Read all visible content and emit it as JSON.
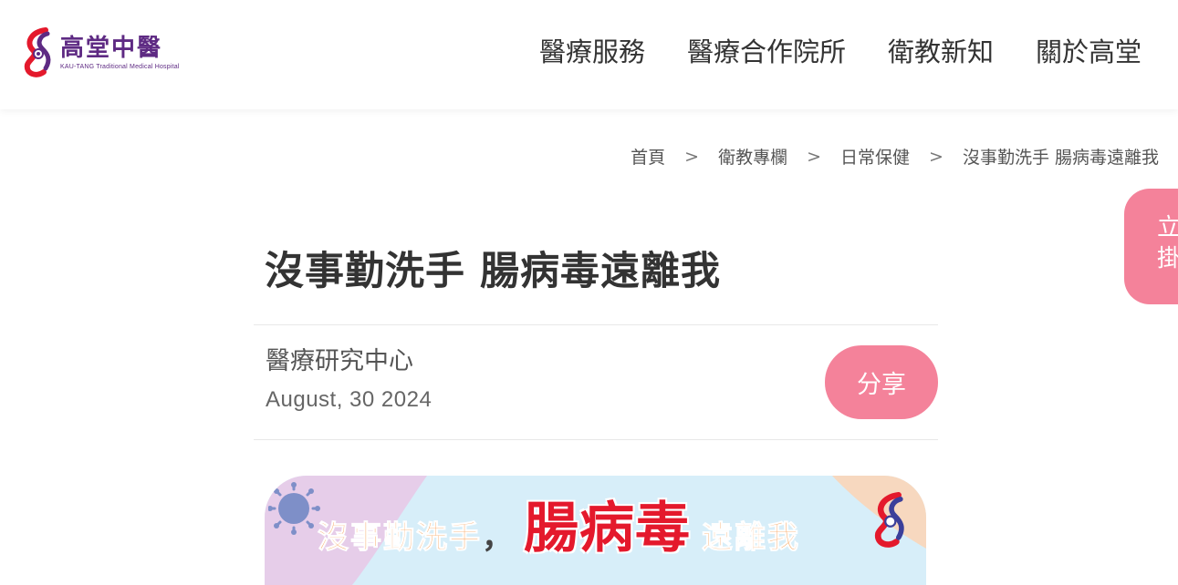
{
  "header": {
    "logo": {
      "name_cn": "高堂中醫",
      "name_en": "KAU-TANG Traditional Medical Hospital"
    },
    "nav": [
      {
        "label": "醫療服務"
      },
      {
        "label": "醫療合作院所"
      },
      {
        "label": "衛教新知"
      },
      {
        "label": "關於高堂"
      }
    ]
  },
  "breadcrumb": {
    "items": [
      "首頁",
      "衛教專欄",
      "日常保健",
      "沒事勤洗手 腸病毒遠離我"
    ],
    "separator": ">"
  },
  "floating_button": {
    "line1": "立",
    "line2": "掛"
  },
  "article": {
    "title": "沒事勤洗手 腸病毒遠離我",
    "author": "醫療研究中心",
    "date": "August, 30 2024",
    "share_label": "分享"
  },
  "banner": {
    "text_part1": "沒事勤洗手",
    "separator": "，",
    "text_main": "腸病毒",
    "text_part2": "遠離我",
    "icons": [
      "virus-icon",
      "logo-mark-icon"
    ]
  },
  "colors": {
    "accent_pink": "#f4829a",
    "brand_purple": "#5e2a83",
    "banner_red": "#e4192c",
    "banner_orange": "#f7a25a",
    "banner_blue": "#d7eef9"
  }
}
